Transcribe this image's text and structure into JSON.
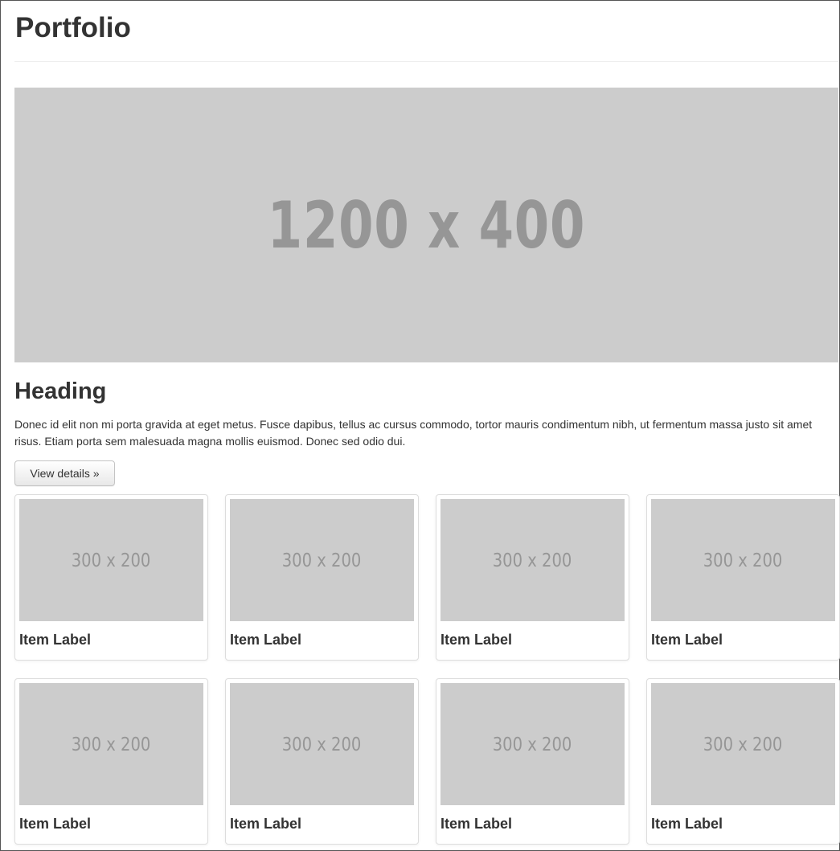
{
  "header": {
    "title": "Portfolio"
  },
  "hero": {
    "placeholder_text": "1200 x 400",
    "background_color": "#cccccc"
  },
  "section": {
    "heading": "Heading",
    "body": "Donec id elit non mi porta gravida at eget metus. Fusce dapibus, tellus ac cursus commodo, tortor mauris condimentum nibh, ut fermentum massa justo sit amet risus. Etiam porta sem malesuada magna mollis euismod. Donec sed odio dui.",
    "button_label": "View details »"
  },
  "thumbnails": [
    {
      "image_text": "300 x 200",
      "label": "Item Label"
    },
    {
      "image_text": "300 x 200",
      "label": "Item Label"
    },
    {
      "image_text": "300 x 200",
      "label": "Item Label"
    },
    {
      "image_text": "300 x 200",
      "label": "Item Label"
    },
    {
      "image_text": "300 x 200",
      "label": "Item Label"
    },
    {
      "image_text": "300 x 200",
      "label": "Item Label"
    },
    {
      "image_text": "300 x 200",
      "label": "Item Label"
    },
    {
      "image_text": "300 x 200",
      "label": "Item Label"
    }
  ]
}
